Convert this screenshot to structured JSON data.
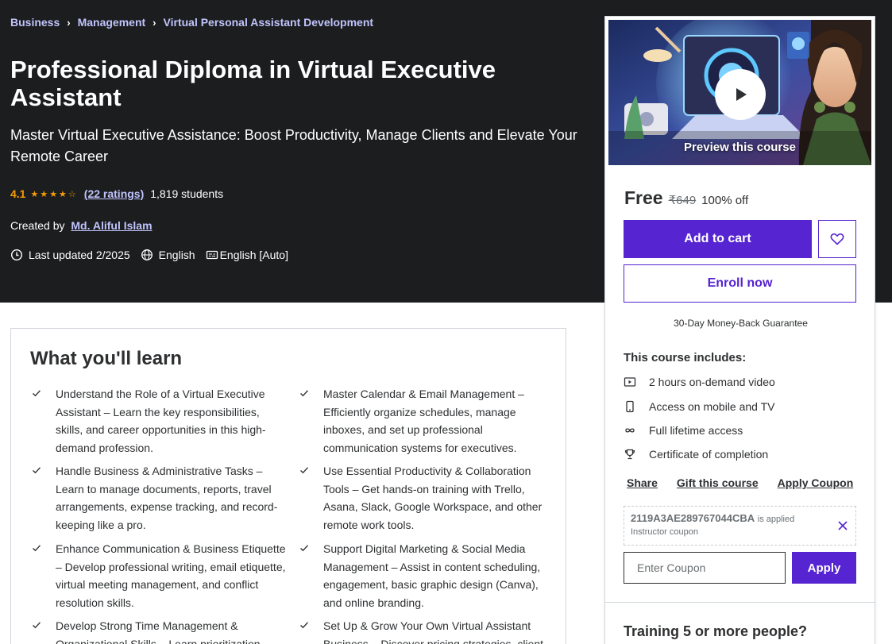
{
  "breadcrumb": [
    "Business",
    "Management",
    "Virtual Personal Assistant Development"
  ],
  "course": {
    "title": "Professional Diploma in Virtual Executive Assistant",
    "subtitle": "Master Virtual Executive Assistance: Boost Productivity, Manage Clients and Elevate Your Remote Career",
    "rating": "4.1",
    "ratings_count": "(22 ratings)",
    "students": "1,819 students",
    "created_by_label": "Created by",
    "instructor": "Md. Aliful Islam",
    "last_updated": "Last updated 2/2025",
    "language": "English",
    "captions": "English [Auto]"
  },
  "learn": {
    "title": "What you'll learn",
    "items": [
      "Understand the Role of a Virtual Executive Assistant – Learn the key responsibilities, skills, and career opportunities in this high-demand profession.",
      "Master Calendar & Email Management – Efficiently organize schedules, manage inboxes, and set up professional communication systems for executives.",
      "Handle Business & Administrative Tasks – Learn to manage documents, reports, travel arrangements, expense tracking, and record-keeping like a pro.",
      "Use Essential Productivity & Collaboration Tools – Get hands-on training with Trello, Asana, Slack, Google Workspace, and other remote work tools.",
      "Enhance Communication & Business Etiquette – Develop professional writing, email etiquette, virtual meeting management, and conflict resolution skills.",
      "Support Digital Marketing & Social Media Management – Assist in content scheduling, engagement, basic graphic design (Canva), and online branding.",
      "Develop Strong Time Management & Organizational Skills – Learn prioritization",
      "Set Up & Grow Your Own Virtual Assistant Business – Discover pricing strategies, client"
    ]
  },
  "sidebar": {
    "preview_label": "Preview this course",
    "price_free": "Free",
    "price_old": "₹649",
    "discount": "100% off",
    "add_to_cart": "Add to cart",
    "enroll_now": "Enroll now",
    "guarantee": "30-Day Money-Back Guarantee",
    "includes_title": "This course includes:",
    "includes": [
      {
        "icon": "video-icon",
        "text": "2 hours on-demand video"
      },
      {
        "icon": "mobile-icon",
        "text": "Access on mobile and TV"
      },
      {
        "icon": "infinity-icon",
        "text": "Full lifetime access"
      },
      {
        "icon": "trophy-icon",
        "text": "Certificate of completion"
      }
    ],
    "share": "Share",
    "gift": "Gift this course",
    "apply_coupon_link": "Apply Coupon",
    "coupon_code": "2119A3AE289767044CBA",
    "coupon_applied": "is applied",
    "coupon_type": "Instructor coupon",
    "coupon_placeholder": "Enter Coupon",
    "apply_button": "Apply",
    "training_title": "Training 5 or more people?"
  },
  "colors": {
    "accent": "#5624d0",
    "hero_bg": "#1c1d1f",
    "star": "#f69c08",
    "link_light": "#c0c4fc"
  }
}
